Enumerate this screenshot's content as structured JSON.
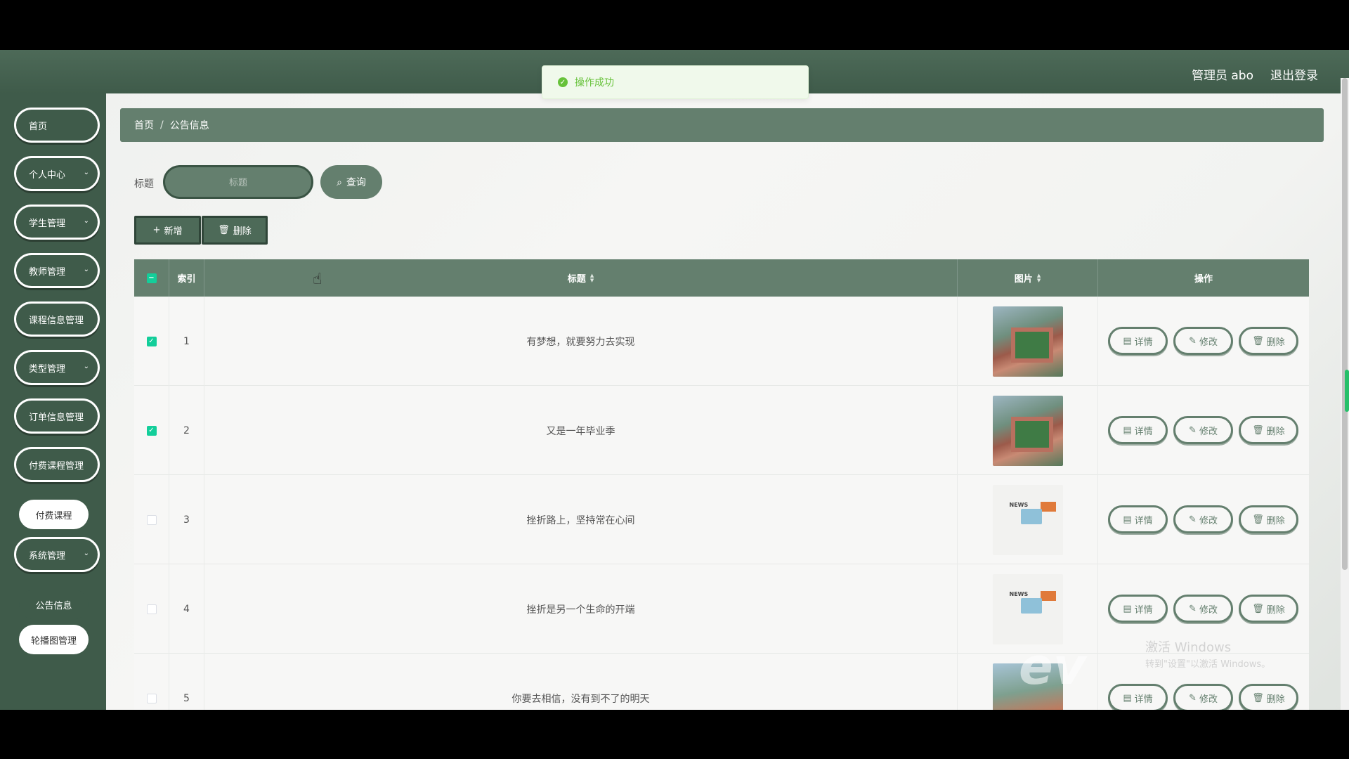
{
  "header": {
    "user_label": "管理员 abo",
    "logout": "退出登录"
  },
  "toast": {
    "message": "操作成功"
  },
  "sidebar": {
    "items": [
      {
        "label": "首页",
        "expandable": false
      },
      {
        "label": "个人中心",
        "expandable": true
      },
      {
        "label": "学生管理",
        "expandable": true
      },
      {
        "label": "教师管理",
        "expandable": true
      },
      {
        "label": "课程信息管理",
        "expandable": true
      },
      {
        "label": "类型管理",
        "expandable": true
      },
      {
        "label": "订单信息管理",
        "expandable": true
      },
      {
        "label": "付费课程管理",
        "expandable": true
      },
      {
        "label": "付费课程",
        "sub": true
      },
      {
        "label": "系统管理",
        "expandable": true
      },
      {
        "label": "公告信息",
        "sub": true,
        "active": true
      },
      {
        "label": "轮播图管理",
        "sub": true
      }
    ]
  },
  "breadcrumb": {
    "home": "首页",
    "separator": "/",
    "current": "公告信息"
  },
  "search": {
    "label": "标题",
    "placeholder": "标题",
    "button": "查询"
  },
  "actions": {
    "add": "新增",
    "delete": "删除"
  },
  "table": {
    "headers": {
      "index": "索引",
      "title": "标题",
      "image": "图片",
      "ops": "操作"
    },
    "rows": [
      {
        "index": "1",
        "title": "有梦想，就要努力去实现",
        "checked": true,
        "image": "campus"
      },
      {
        "index": "2",
        "title": "又是一年毕业季",
        "checked": true,
        "image": "campus"
      },
      {
        "index": "3",
        "title": "挫折路上，坚持常在心间",
        "checked": false,
        "image": "news"
      },
      {
        "index": "4",
        "title": "挫折是另一个生命的开端",
        "checked": false,
        "image": "news"
      },
      {
        "index": "5",
        "title": "你要去相信，没有到不了的明天",
        "checked": false,
        "image": "building"
      }
    ],
    "row_actions": {
      "detail": "详情",
      "edit": "修改",
      "delete": "删除"
    }
  },
  "watermark": {
    "line1": "激活 Windows",
    "line2": "转到\"设置\"以激活 Windows。",
    "ev": "ev"
  },
  "colors": {
    "primary": "#647f6e",
    "dark": "#3f5b4a",
    "check": "#13ce9a",
    "success": "#67c23a"
  }
}
